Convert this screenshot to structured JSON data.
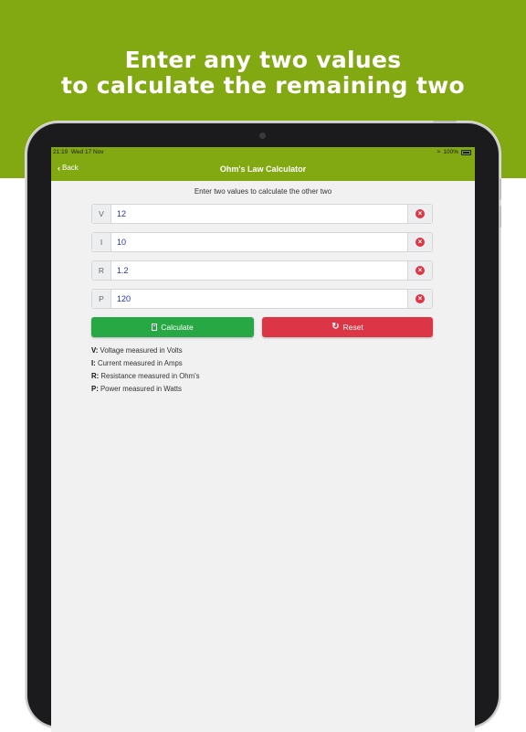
{
  "promo": {
    "line1": "Enter any two values",
    "line2": "to calculate the remaining two",
    "band_color": "#82a812"
  },
  "statusbar": {
    "time": "21:19",
    "date": "Wed 17 Nov",
    "battery": "100%",
    "wifi_icon": "wifi-icon",
    "battery_icon": "battery-charging-icon"
  },
  "navbar": {
    "back_label": "Back",
    "title": "Ohm's Law Calculator"
  },
  "main": {
    "instructions": "Enter two values to calculate the other two",
    "fields": [
      {
        "prefix": "V",
        "value": "12"
      },
      {
        "prefix": "I",
        "value": "10"
      },
      {
        "prefix": "R",
        "value": "1.2"
      },
      {
        "prefix": "P",
        "value": "120"
      }
    ],
    "calculate_label": "Calculate",
    "reset_label": "Reset",
    "legend": [
      {
        "key": "V:",
        "text": "Voltage measured in Volts"
      },
      {
        "key": "I:",
        "text": "Current measured in Amps"
      },
      {
        "key": "R:",
        "text": "Resistance measured in Ohm's"
      },
      {
        "key": "P:",
        "text": "Power measured in Watts"
      }
    ]
  },
  "colors": {
    "accent": "#82a812",
    "calculate": "#28a745",
    "reset": "#dc3545"
  }
}
